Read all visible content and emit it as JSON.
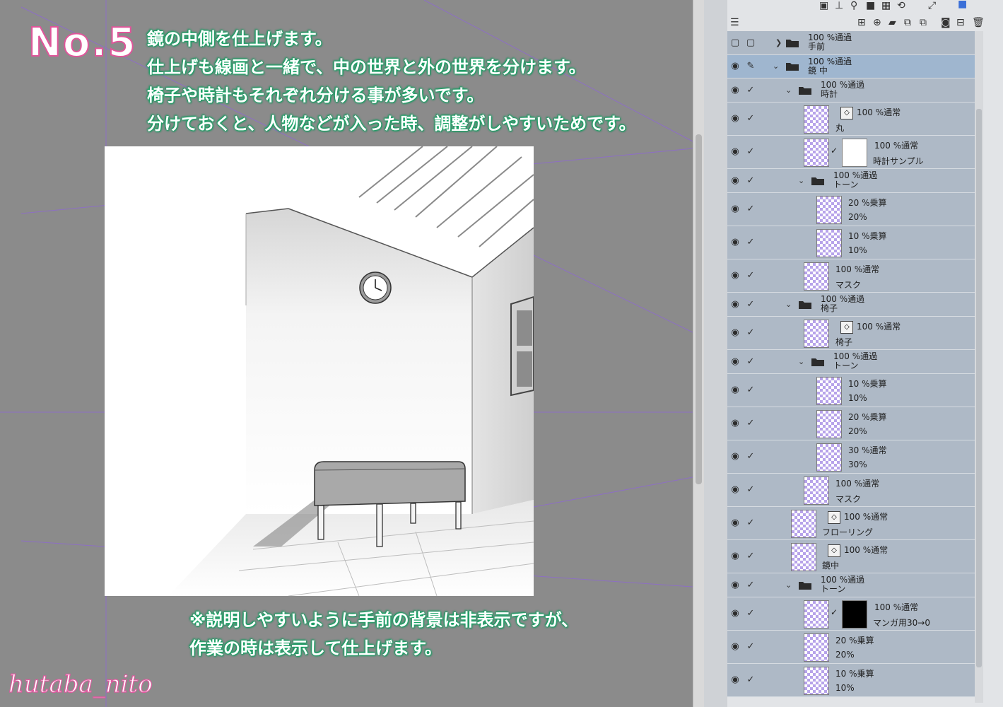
{
  "step": {
    "label": "No.5"
  },
  "notes": {
    "line1": "鏡の中側を仕上げます。",
    "line2": "仕上げも線画と一緒で、中の世界と外の世界を分けます。",
    "line3": "椅子や時計もそれぞれ分ける事が多いです。",
    "line4": "分けておくと、人物などが入った時、調整がしやすいためです。",
    "footer1": "※説明しやすいように手前の背景は非表示ですが、",
    "footer2": "作業の時は表示して仕上げます。"
  },
  "signature": "hutaba_nito",
  "layers": [
    {
      "f1": "100 %通過",
      "f2": "手前"
    },
    {
      "f1": "100 %通過",
      "f2": "鏡 中"
    },
    {
      "f1": "100 %通過",
      "f2": "時計"
    },
    {
      "t1": "100 %通常",
      "t2": "丸"
    },
    {
      "t1": "100 %通常",
      "t2": "時計サンプル"
    },
    {
      "f1": "100 %通過",
      "f2": "トーン"
    },
    {
      "t1": "20 %乗算",
      "t2": "20%"
    },
    {
      "t1": "10 %乗算",
      "t2": "10%"
    },
    {
      "t1": "100 %通常",
      "t2": "マスク"
    },
    {
      "f1": "100 %通過",
      "f2": "椅子"
    },
    {
      "t1": "100 %通常",
      "t2": "椅子"
    },
    {
      "f1": "100 %通過",
      "f2": "トーン"
    },
    {
      "t1": "10 %乗算",
      "t2": "10%"
    },
    {
      "t1": "20 %乗算",
      "t2": "20%"
    },
    {
      "t1": "30 %通常",
      "t2": "30%"
    },
    {
      "t1": "100 %通常",
      "t2": "マスク"
    },
    {
      "t1": "100 %通常",
      "t2": "フローリング"
    },
    {
      "t1": "100 %通常",
      "t2": "鏡中"
    },
    {
      "f1": "100 %通過",
      "f2": "トーン"
    },
    {
      "t1": "100 %通常",
      "t2": "マンガ用30→0"
    },
    {
      "t1": "20 %乗算",
      "t2": "20%"
    },
    {
      "t1": "10 %乗算",
      "t2": "10%"
    }
  ],
  "colors": {
    "active_row": "#9fb6cf",
    "row": "#aeb9c6",
    "note_green": "#1aa86a",
    "accent_pink": "#e0559a"
  }
}
